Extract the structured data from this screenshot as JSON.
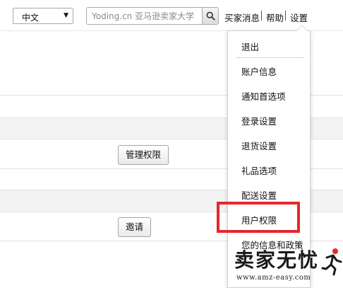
{
  "header": {
    "language": {
      "selected": "中文"
    },
    "search": {
      "placeholder": "Yoding.cn 亚马逊卖家大学"
    },
    "nav": {
      "buyer_messages": "买家消息",
      "help": "帮助",
      "settings": "设置"
    }
  },
  "main": {
    "manage_permissions_button": "管理权限",
    "invite_button": "邀请"
  },
  "settings_menu": {
    "items": [
      {
        "label": "退出"
      },
      {
        "label": "账户信息"
      },
      {
        "label": "通知首选项"
      },
      {
        "label": "登录设置"
      },
      {
        "label": "退货设置"
      },
      {
        "label": "礼品选项"
      },
      {
        "label": "配送设置"
      },
      {
        "label": "用户权限",
        "highlighted": true
      },
      {
        "label": "您的信息和政策"
      }
    ]
  },
  "highlight_color": "#e8262b",
  "watermark": {
    "title": "卖家无忧",
    "url": "www.amz-easy.com",
    "logo_icon": "runner-logo-icon"
  }
}
